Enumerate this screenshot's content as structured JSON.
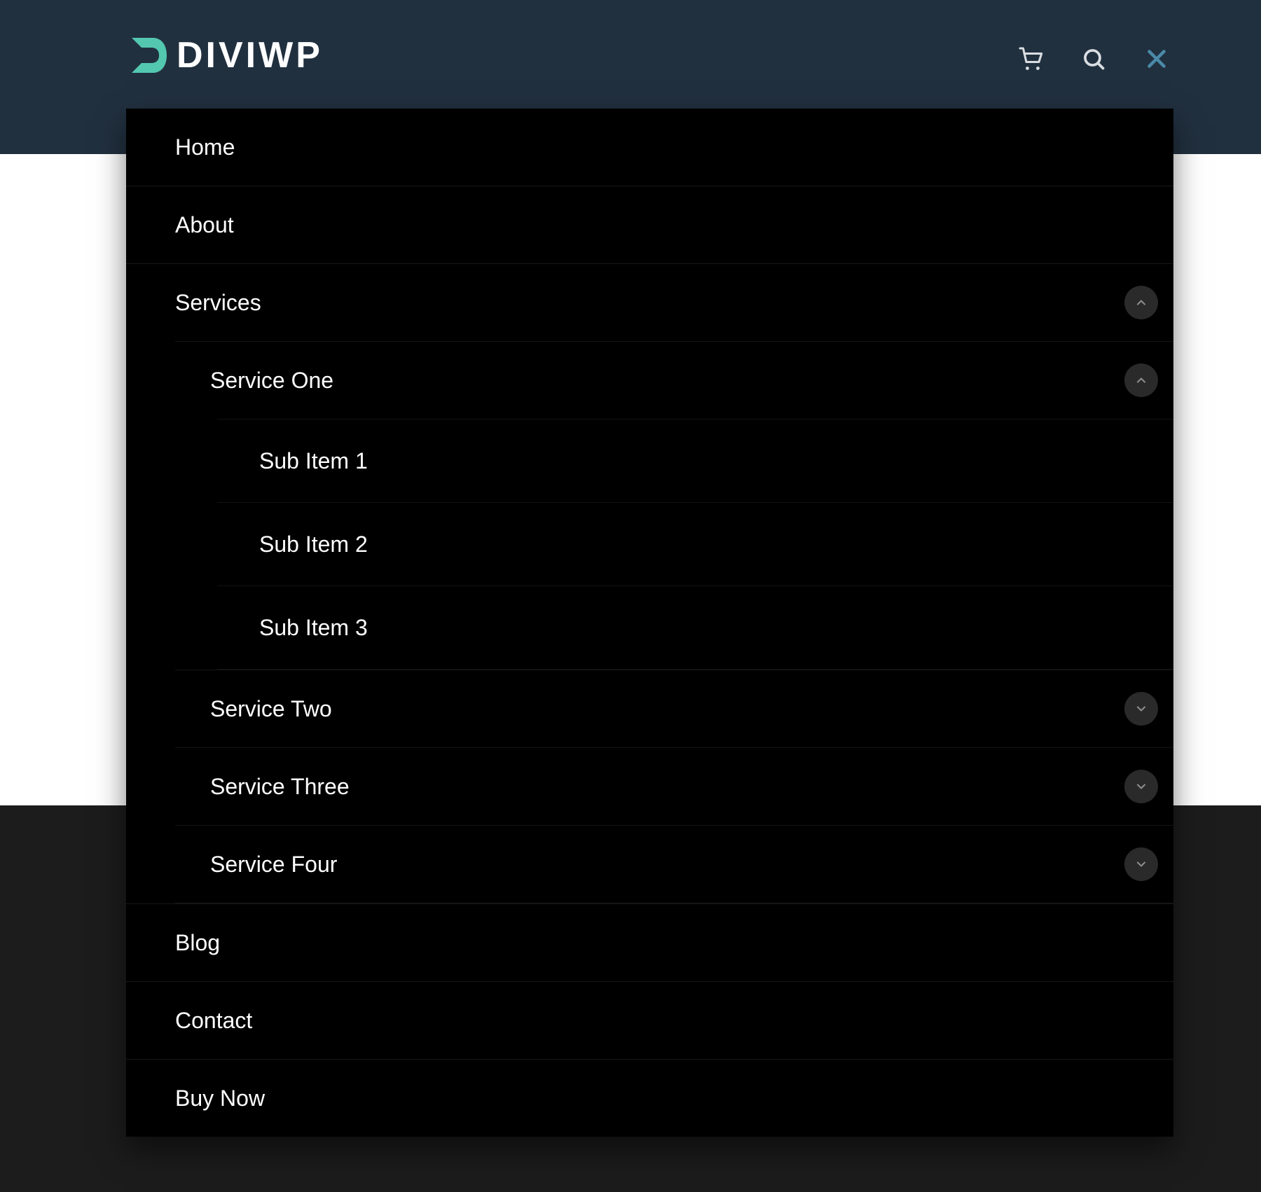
{
  "brand": {
    "name": "DIVIWP",
    "accent": "#53c7b0"
  },
  "header": {
    "icons": {
      "cart": "cart-icon",
      "search": "search-icon",
      "close": "close-icon"
    }
  },
  "menu": {
    "items": [
      {
        "label": "Home"
      },
      {
        "label": "About"
      },
      {
        "label": "Services",
        "expanded": true,
        "children": [
          {
            "label": "Service One",
            "expanded": true,
            "children": [
              {
                "label": "Sub Item 1"
              },
              {
                "label": "Sub Item 2"
              },
              {
                "label": "Sub Item 3"
              }
            ]
          },
          {
            "label": "Service Two",
            "expanded": false,
            "children": []
          },
          {
            "label": "Service Three",
            "expanded": false,
            "children": []
          },
          {
            "label": "Service Four",
            "expanded": false,
            "children": []
          }
        ]
      },
      {
        "label": "Blog"
      },
      {
        "label": "Contact"
      },
      {
        "label": "Buy Now"
      }
    ]
  }
}
